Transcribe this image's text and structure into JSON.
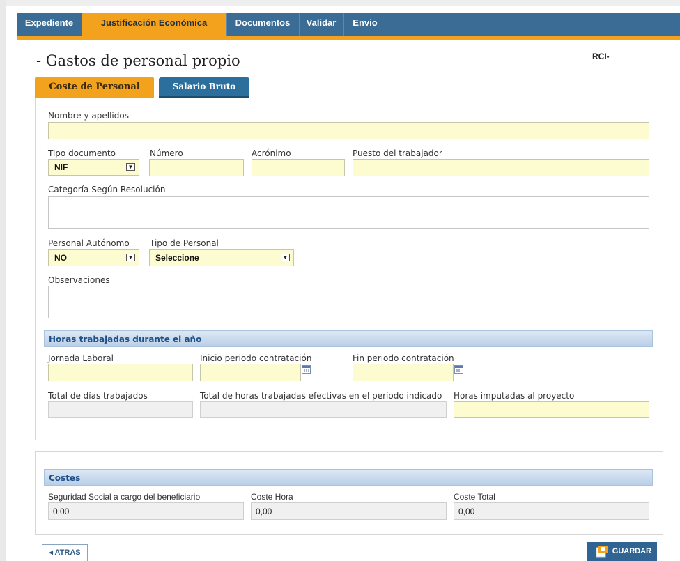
{
  "nav": {
    "tabs": [
      {
        "label": "Expediente"
      },
      {
        "label": "Justificación Económica"
      },
      {
        "label": "Documentos"
      },
      {
        "label": "Validar"
      },
      {
        "label": "Envio"
      }
    ],
    "active_tab": "Justificación Económica"
  },
  "page": {
    "title": "- Gastos de personal propio",
    "rci_label": "RCI-"
  },
  "subtabs": [
    {
      "label": "Coste de Personal",
      "active": true
    },
    {
      "label": "Salario Bruto",
      "active": false
    }
  ],
  "form": {
    "nombre": {
      "label": "Nombre y apellidos",
      "value": ""
    },
    "tipo_documento": {
      "label": "Tipo documento",
      "value": "NIF"
    },
    "numero": {
      "label": "Número",
      "value": ""
    },
    "acronimo": {
      "label": "Acrónimo",
      "value": ""
    },
    "puesto": {
      "label": "Puesto del trabajador",
      "value": ""
    },
    "categoria": {
      "label": "Categoría Según Resolución",
      "value": ""
    },
    "personal_autonomo": {
      "label": "Personal Autónomo",
      "value": "NO"
    },
    "tipo_personal": {
      "label": "Tipo de Personal",
      "value": "Seleccione"
    },
    "observaciones": {
      "label": "Observaciones",
      "value": ""
    }
  },
  "horas": {
    "section_title": "Horas trabajadas durante el año",
    "jornada": {
      "label": "Jornada Laboral",
      "value": ""
    },
    "inicio": {
      "label": "Inicio periodo contratación",
      "value": ""
    },
    "fin": {
      "label": "Fin periodo contratación",
      "value": ""
    },
    "total_dias": {
      "label": "Total de días trabajados",
      "value": ""
    },
    "total_horas": {
      "label": "Total de horas trabajadas efectivas en el período indicado",
      "value": ""
    },
    "horas_imputadas": {
      "label": "Horas imputadas al proyecto",
      "value": ""
    }
  },
  "costes": {
    "section_title": "Costes",
    "seguridad_social": {
      "label": "Seguridad Social a cargo del beneficiario",
      "value": "0,00"
    },
    "coste_hora": {
      "label": "Coste Hora",
      "value": "0,00"
    },
    "coste_total": {
      "label": "Coste Total",
      "value": "0,00"
    }
  },
  "buttons": {
    "atras": "◂ ATRAS",
    "guardar": "GUARDAR"
  },
  "colors": {
    "nav_blue": "#3a6c95",
    "accent_orange": "#f3a21e",
    "input_yellow": "#fdfbd0",
    "section_blue_text": "#1f4f86"
  }
}
